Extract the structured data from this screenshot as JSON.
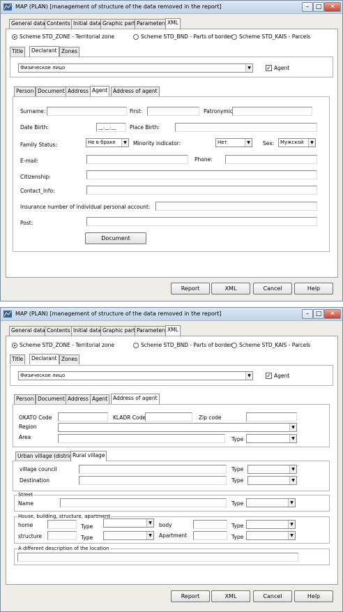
{
  "window": {
    "title": "MAP (PLAN) [management of structure of the data removed in the report]",
    "minimize": "–",
    "maximize": "□",
    "close": "✕"
  },
  "main_tabs": [
    "General data",
    "Contents",
    "Initial data",
    "Graphic part",
    "Parameters",
    "XML"
  ],
  "schemes": [
    "Scheme STD_ZONE - Territorial zone",
    "Scheme STD_BND - Parts of border",
    "Scheme STD_KAIS - Parcels"
  ],
  "sub_tabs": [
    "Title",
    "Declarant",
    "Zones"
  ],
  "declarant_type": "Физическое лицо",
  "agent_label": "Agent",
  "agent_check": "✓",
  "inner_tabs": [
    "Person",
    "Document",
    "Address",
    "Agent",
    "Address of agent"
  ],
  "person": {
    "surname": "Surname:",
    "first": "First:",
    "patronymic": "Patronymic:",
    "date_birth": "Date Birth:",
    "date_mask": "__.__.__",
    "place_birth": "Place Birth:",
    "family_status": "Family Status:",
    "family_value": "Не в браке",
    "minority": "Minority indicator:",
    "minority_value": "Нет",
    "sex": "Sex:",
    "sex_value": "Мужской",
    "email": "E-mail:",
    "phone": "Phone:",
    "citizenship": "Citizenship:",
    "contact": "Contact_Info:",
    "insurance": "Insurance number of individual personal account:",
    "post": "Post:",
    "document_btn": "Document"
  },
  "address": {
    "okato": "OKATO Code",
    "kladr": "KLADR Code",
    "zip": "Zip code",
    "region": "Region",
    "area": "Area",
    "type": "Type",
    "village_tabs": [
      "Urban village (district)",
      "Rural village"
    ],
    "village_council": "village council",
    "destination": "Destination",
    "street_group": "Street",
    "name": "Name",
    "house_group": "House, building, structure, apartment",
    "home": "home",
    "body": "body",
    "structure": "structure",
    "apartment": "Apartment",
    "other_group": "A different description of the location"
  },
  "buttons": {
    "report": "Report",
    "xml": "XML",
    "cancel": "Cancel",
    "help": "Help"
  },
  "icons": {
    "app": "map-app-icon",
    "dropdown": "chevron-down-icon"
  },
  "colors": {
    "titlebar": "#c3d4e8",
    "face": "#eeede7",
    "close": "#c7442c"
  }
}
